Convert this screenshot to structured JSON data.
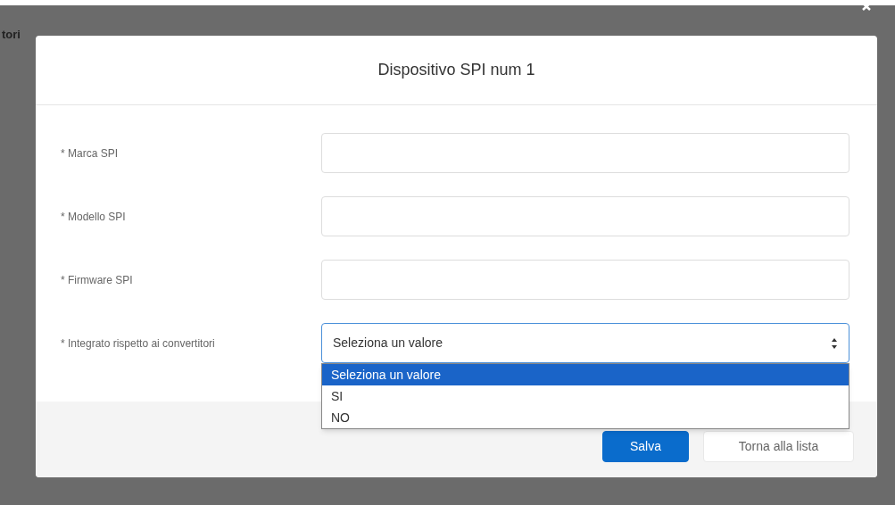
{
  "background": {
    "heading": "tori"
  },
  "modal": {
    "title": "Dispositivo SPI num 1",
    "fields": [
      {
        "kind": "text",
        "label": "* Marca SPI"
      },
      {
        "kind": "text",
        "label": "* Modello SPI"
      },
      {
        "kind": "text",
        "label": "* Firmware SPI"
      },
      {
        "kind": "select",
        "label": "* Integrato rispetto ai convertitori",
        "value": "Seleziona un valore",
        "expanded": true,
        "options": [
          {
            "label": "Seleziona un valore",
            "selected": true
          },
          {
            "label": "SI",
            "selected": false
          },
          {
            "label": "NO",
            "selected": false
          }
        ]
      }
    ],
    "buttons": [
      {
        "kind": "primary",
        "label": "Salva"
      },
      {
        "kind": "secondary",
        "label": "Torna alla lista"
      }
    ]
  }
}
